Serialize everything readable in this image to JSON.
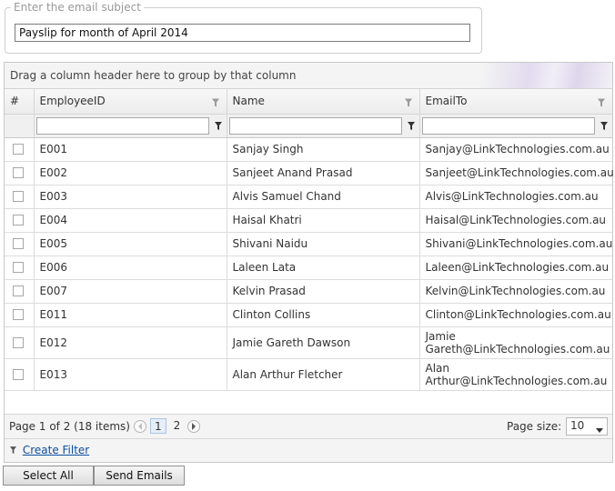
{
  "subject": {
    "legend": "Enter the email subject",
    "value": "Payslip for month of April 2014"
  },
  "grid": {
    "group_panel_text": "Drag a column header here to group by that column",
    "columns": [
      "#",
      "EmployeeID",
      "Name",
      "EmailTo"
    ],
    "rows": [
      {
        "id": "E001",
        "name": "Sanjay Singh",
        "email": "Sanjay@LinkTechnologies.com.au"
      },
      {
        "id": "E002",
        "name": "Sanjeet Anand Prasad",
        "email": "Sanjeet@LinkTechnologies.com.au"
      },
      {
        "id": "E003",
        "name": "Alvis Samuel Chand",
        "email": "Alvis@LinkTechnologies.com.au"
      },
      {
        "id": "E004",
        "name": "Haisal Khatri",
        "email": "Haisal@LinkTechnologies.com.au"
      },
      {
        "id": "E005",
        "name": "Shivani Naidu",
        "email": "Shivani@LinkTechnologies.com.au"
      },
      {
        "id": "E006",
        "name": "Laleen Lata",
        "email": "Laleen@LinkTechnologies.com.au"
      },
      {
        "id": "E007",
        "name": "Kelvin Prasad",
        "email": "Kelvin@LinkTechnologies.com.au"
      },
      {
        "id": "E011",
        "name": "Clinton Collins",
        "email": "Clinton@LinkTechnologies.com.au"
      },
      {
        "id": "E012",
        "name": "Jamie Gareth Dawson",
        "email_line1": "Jamie",
        "email_line2": "Gareth@LinkTechnologies.com.au"
      },
      {
        "id": "E013",
        "name": "Alan Arthur Fletcher",
        "email_line1": "Alan",
        "email_line2": "Arthur@LinkTechnologies.com.au"
      }
    ]
  },
  "pager": {
    "info": "Page 1 of 2 (18 items)",
    "pages": [
      "1",
      "2"
    ],
    "page_size_label": "Page size:",
    "page_size_value": "10"
  },
  "filter_bar": {
    "create_filter_label": "Create Filter"
  },
  "buttons": {
    "select_all": "Select All",
    "send_emails": "Send Emails"
  },
  "icons": {
    "filter": "funnel-icon",
    "prev": "chevron-left-icon",
    "next": "chevron-right-icon",
    "dropdown": "chevron-down-icon"
  }
}
